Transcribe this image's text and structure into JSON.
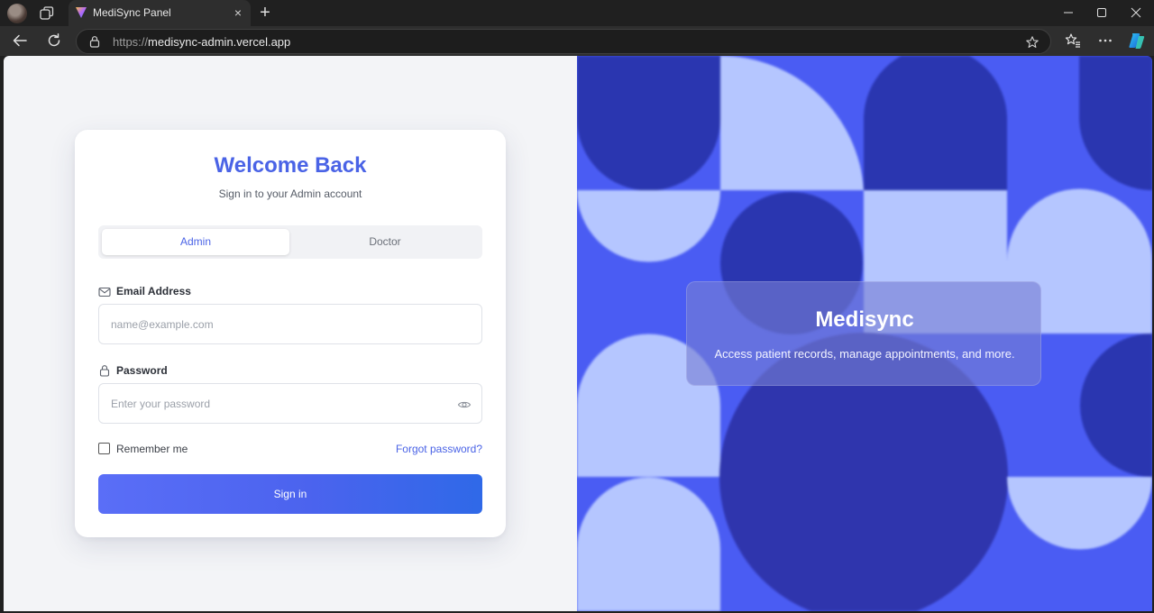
{
  "browser": {
    "tab_title": "MediSync Panel",
    "tab_close": "×",
    "new_tab": "+",
    "url_scheme": "https://",
    "url_host": "medisync-admin.vercel.app"
  },
  "login": {
    "title": "Welcome Back",
    "subtitle": "Sign in to your Admin account",
    "roles": [
      {
        "label": "Admin",
        "active": true
      },
      {
        "label": "Doctor",
        "active": false
      }
    ],
    "email": {
      "label": "Email Address",
      "placeholder": "name@example.com",
      "value": ""
    },
    "password": {
      "label": "Password",
      "placeholder": "Enter your password",
      "value": ""
    },
    "remember_label": "Remember me",
    "remember_checked": false,
    "forgot_label": "Forgot password?",
    "submit_label": "Sign in"
  },
  "brand": {
    "title": "Medisync",
    "tagline": "Access patient records, manage appointments, and more."
  },
  "colors": {
    "accent": "#4a63e6",
    "pattern_base": "#4a5cf3",
    "pattern_dark": "#2a36b0",
    "pattern_light": "#b5c6ff"
  },
  "icons": [
    "profile-avatar",
    "tab-actions-icon",
    "app-favicon",
    "close-icon",
    "plus-icon",
    "minimize-icon",
    "maximize-icon",
    "window-close-icon",
    "back-arrow-icon",
    "refresh-icon",
    "lock-icon",
    "star-icon",
    "favorites-icon",
    "more-icon",
    "copilot-icon",
    "mail-icon",
    "padlock-icon",
    "eye-icon"
  ]
}
